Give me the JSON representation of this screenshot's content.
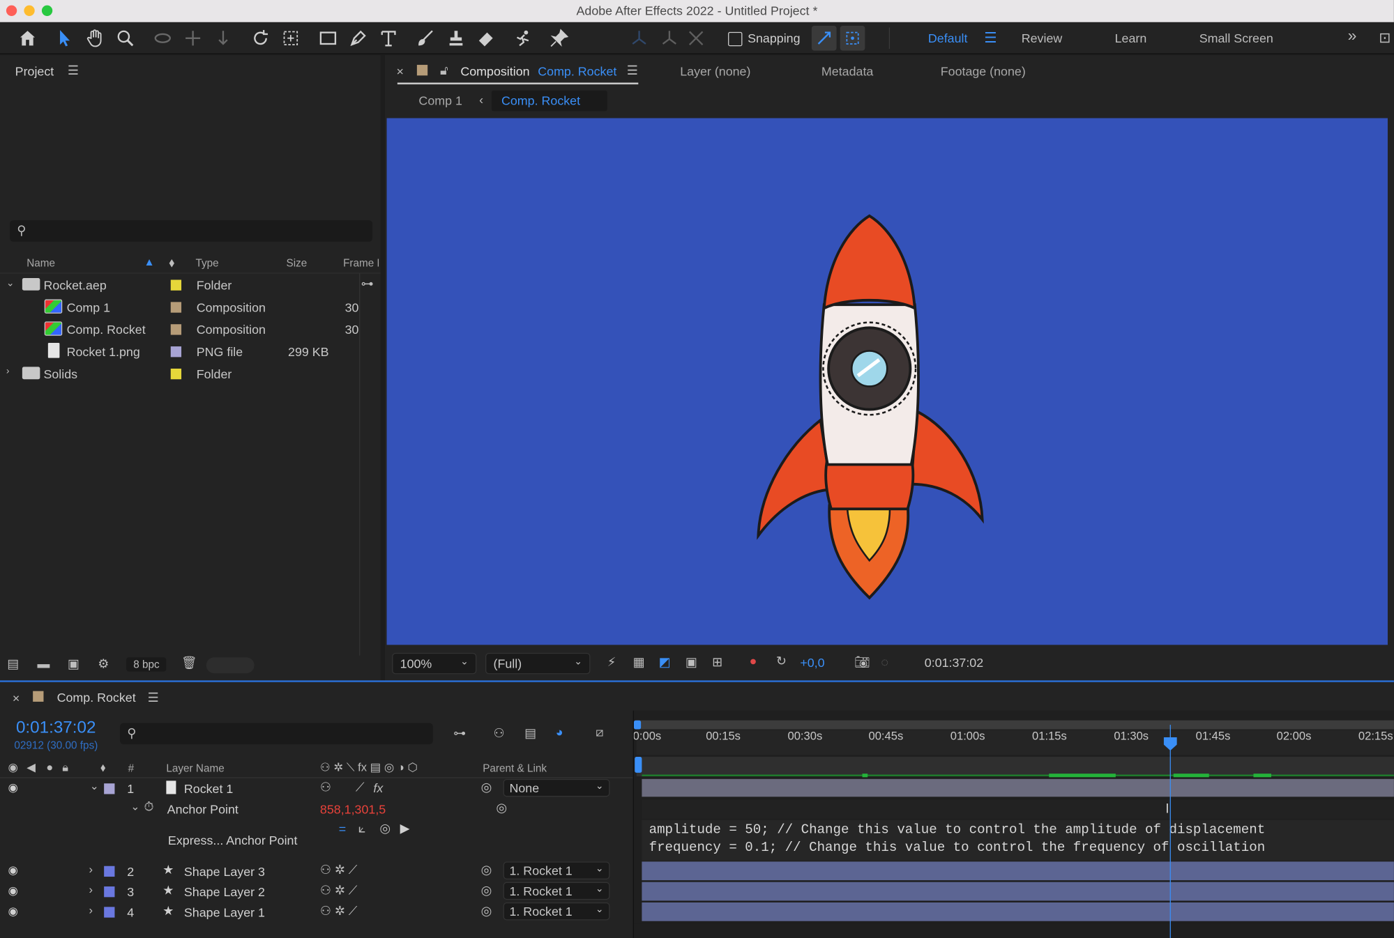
{
  "window": {
    "title": "Adobe After Effects 2022 - Untitled Project *"
  },
  "toolbar": {
    "snapping_label": "Snapping",
    "workspaces": [
      "Default",
      "Review",
      "Learn",
      "Small Screen"
    ]
  },
  "project": {
    "title": "Project",
    "search_placeholder": "",
    "columns": {
      "name": "Name",
      "type": "Type",
      "size": "Size",
      "frame": "Frame R"
    },
    "items": [
      {
        "name": "Rocket.aep",
        "type": "Folder",
        "size": "",
        "frame": "",
        "color": "#e6d73a"
      },
      {
        "name": "Comp 1",
        "type": "Composition",
        "size": "",
        "frame": "30",
        "color": "#b69c78"
      },
      {
        "name": "Comp. Rocket",
        "type": "Composition",
        "size": "",
        "frame": "30",
        "color": "#b69c78"
      },
      {
        "name": "Rocket 1.png",
        "type": "PNG file",
        "size": "299 KB",
        "frame": "",
        "color": "#a8a4d4"
      },
      {
        "name": "Solids",
        "type": "Folder",
        "size": "",
        "frame": "",
        "color": "#e6d73a"
      }
    ],
    "bpc": "8 bpc"
  },
  "viewer": {
    "tab_prefix": "Composition",
    "tab_comp": "Comp. Rocket",
    "other_tabs": [
      "Layer (none)",
      "Metadata",
      "Footage (none)"
    ],
    "breadcrumb": [
      "Comp 1",
      "Comp. Rocket"
    ],
    "bg_color": "#3452b9",
    "zoom": "100%",
    "resolution": "(Full)",
    "exposure": "+0,0",
    "timecode": "0:01:37:02"
  },
  "timeline": {
    "comp_name": "Comp. Rocket",
    "timecode": "0:01:37:02",
    "frame_info": "02912 (30.00 fps)",
    "ruler": [
      "0:00s",
      "00:15s",
      "00:30s",
      "00:45s",
      "01:00s",
      "01:15s",
      "01:30s",
      "01:45s",
      "02:00s",
      "02:15s"
    ],
    "columns": {
      "num": "#",
      "layer_name": "Layer Name",
      "parent": "Parent & Link"
    },
    "layers": [
      {
        "num": "1",
        "name": "Rocket 1",
        "parent": "None",
        "color": "#a8a4d4"
      },
      {
        "num": "2",
        "name": "Shape Layer 3",
        "parent": "1. Rocket 1",
        "color": "#6a78e0"
      },
      {
        "num": "3",
        "name": "Shape Layer 2",
        "parent": "1. Rocket 1",
        "color": "#6a78e0"
      },
      {
        "num": "4",
        "name": "Shape Layer 1",
        "parent": "1. Rocket 1",
        "color": "#6a78e0"
      }
    ],
    "property": {
      "name": "Anchor Point",
      "value": "858,1,301,5"
    },
    "expression_label": "Express... Anchor Point",
    "expression_lines": [
      "amplitude = 50; // Change this value to control the amplitude of displacement",
      "frequency = 0.1; // Change this value to control the frequency of oscillation"
    ]
  }
}
